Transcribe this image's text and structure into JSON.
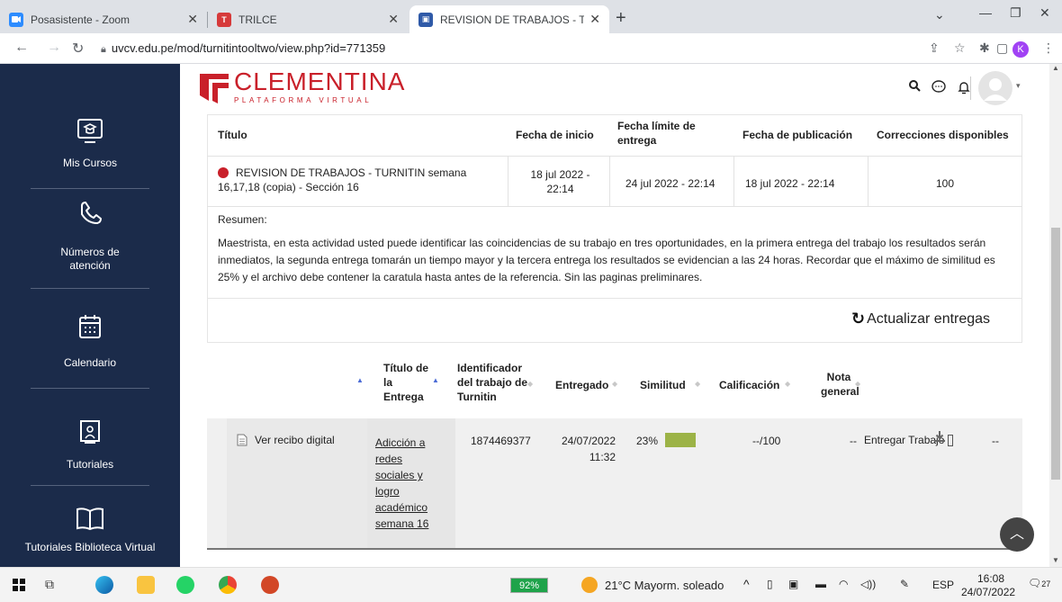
{
  "browser": {
    "tabs": [
      {
        "title": "Posasistente - Zoom",
        "color": "#2d8cff"
      },
      {
        "title": "TRILCE",
        "color": "#d63a3a"
      },
      {
        "title": "REVISION DE TRABAJOS - TURNI",
        "color": "#2f5aa8",
        "active": true
      }
    ],
    "url": "uvcv.edu.pe/mod/turnitintooltwo/view.php?id=771359",
    "profile_initial": "K"
  },
  "sidebar": {
    "items": [
      {
        "label": "Mis Cursos",
        "icon": "course-icon"
      },
      {
        "label": "Números de atención",
        "icon": "phone-icon"
      },
      {
        "label": "Calendario",
        "icon": "calendar-icon"
      },
      {
        "label": "Tutoriales",
        "icon": "tutorial-icon"
      },
      {
        "label": "Tutoriales Biblioteca Virtual",
        "icon": "book-icon"
      }
    ]
  },
  "header": {
    "logo_title": "CLEMENTINA",
    "logo_subtitle": "PLATAFORMA VIRTUAL"
  },
  "assignment": {
    "columns": [
      "Título",
      "Fecha de inicio",
      "Fecha límite de entrega",
      "Fecha de publicación",
      "Correcciones disponibles"
    ],
    "title": "REVISION DE TRABAJOS - TURNITIN semana 16,17,18 (copia) - Sección 16",
    "start": "18 jul 2022 - 22:14",
    "due": "24 jul 2022 - 22:14",
    "post": "18 jul 2022 - 22:14",
    "corrections": "100",
    "summary_label": "Resumen:",
    "summary_text": "Maestrista, en esta actividad usted puede identificar  las coincidencias de su trabajo en tres oportunidades, en la primera  entrega del trabajo los resultados serán inmediatos, la segunda entrega  tomarán un tiempo  mayor y la tercera entrega los resultados se evidencian a las 24 horas. Recordar que el  máximo de similitud es 25% y  el archivo debe contener  la caratula hasta antes de la referencia. Sin las paginas preliminares.",
    "refresh_label": "Actualizar entregas"
  },
  "submissions": {
    "columns": {
      "title": "Título de la Entrega",
      "id": "Identificador del trabajo de Turnitin",
      "submitted": "Entregado",
      "similarity": "Similitud",
      "grade": "Calificación",
      "overall": "Nota general"
    },
    "row": {
      "receipt": "Ver recibo digital",
      "title": "Adicción a redes sociales y logro académico semana 16",
      "id": "1874469377",
      "date": "24/07/2022",
      "time": "11:32",
      "similarity": "23%",
      "similarity_color": "#9cb347",
      "grade": "--/100",
      "overall": "--",
      "submit": "Entregar Trabajo",
      "more": "--"
    }
  },
  "taskbar": {
    "battery": "92%",
    "weather": "21°C  Mayorm. soleado",
    "lang": "ESP",
    "time": "16:08",
    "date": "24/07/2022",
    "notifications": "27"
  }
}
